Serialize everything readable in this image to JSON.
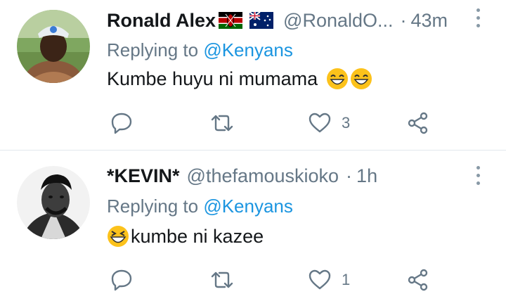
{
  "tweets": [
    {
      "author_name": "Ronald Alex",
      "handle": "@RonaldO...",
      "separator": "·",
      "time": "43m",
      "replying_prefix": "Replying to",
      "replying_to": "@Kenyans",
      "text": "Kumbe huyu ni mumama",
      "likes": "3",
      "flags": [
        "kenya-flag-icon",
        "australia-flag-icon"
      ]
    },
    {
      "author_name": "*KEVIN*",
      "handle": "@thefamouskioko",
      "separator": "·",
      "time": "1h",
      "replying_prefix": "Replying to",
      "replying_to": "@Kenyans",
      "text": "kumbe ni kazee",
      "likes": "1"
    }
  ],
  "colors": {
    "secondary_text": "#657786",
    "mention": "#1b95e0",
    "divider": "#e1e8ed"
  }
}
